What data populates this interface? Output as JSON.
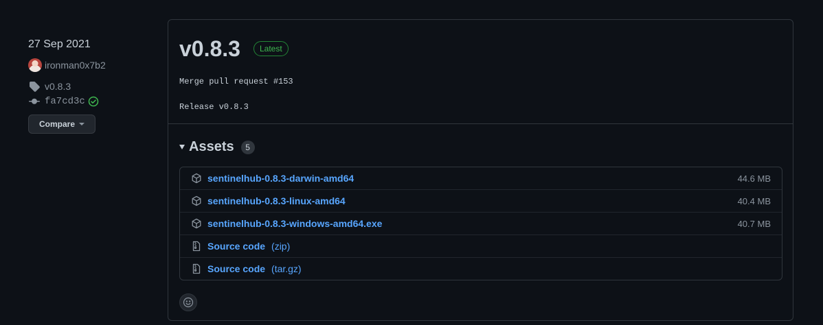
{
  "meta": {
    "date": "27 Sep 2021",
    "author": "ironman0x7b2",
    "tag": "v0.8.3",
    "commit": "fa7cd3c",
    "compare_label": "Compare"
  },
  "release": {
    "title": "v0.8.3",
    "badge": "Latest",
    "body": [
      "Merge pull request #153",
      "Release v0.8.3"
    ]
  },
  "assets": {
    "title": "Assets",
    "count": "5",
    "items": [
      {
        "name": "sentinelhub-0.8.3-darwin-amd64",
        "size": "44.6 MB",
        "icon": "package-icon"
      },
      {
        "name": "sentinelhub-0.8.3-linux-amd64",
        "size": "40.4 MB",
        "icon": "package-icon"
      },
      {
        "name": "sentinelhub-0.8.3-windows-amd64.exe",
        "size": "40.7 MB",
        "icon": "package-icon"
      },
      {
        "name": "Source code",
        "suffix": "(zip)",
        "icon": "file-zip-icon"
      },
      {
        "name": "Source code",
        "suffix": "(tar.gz)",
        "icon": "file-zip-icon"
      }
    ]
  },
  "colors": {
    "background": "#0d1117",
    "border": "#30363d",
    "link": "#58a6ff",
    "success": "#3fb950",
    "muted": "#8b949e"
  }
}
